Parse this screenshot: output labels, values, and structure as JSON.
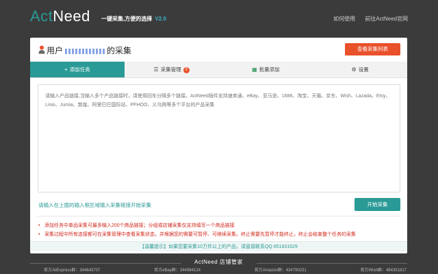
{
  "header": {
    "logo_act": "Act",
    "logo_need": "Need",
    "slogan": "一键采集,方便的选择",
    "version": "V2.0",
    "links": [
      "如何使用",
      "前往ActNeed官网"
    ]
  },
  "card": {
    "title_prefix": "用户",
    "title_suffix": "的采集",
    "view_button": "查看采集列表"
  },
  "tabs": [
    {
      "label": "添加任务",
      "icon": "plus-icon",
      "active": true
    },
    {
      "label": "采集管理",
      "icon": "list-icon",
      "badge": "3"
    },
    {
      "label": "批量添加",
      "icon": "excel-icon"
    },
    {
      "label": "设置",
      "icon": "gear-icon"
    }
  ],
  "textarea": {
    "placeholder": "请输入产品链接,当输入多个产品链接时，请使用回车分隔多个链接。ActNeed插件支持速卖通、eBay、亚马逊、1688、淘宝、天猫、京东、Wish、Lazada、Etsy、Linio、Jumia、敦煌、阿里巴巴国际站、PFHOO、义乌购等多个平台的产品采集"
  },
  "hint": "请输入在上面的输入框区域输入采集链接开始采集",
  "start_button": "开始采集",
  "notes": [
    "添加任务中单品采集可最多输入200个商品链接；分组或店铺采集仅支持填写一个商品链接",
    "采集过程中所有连接都可在采集管理中查看采集状态，并根据您的需要可暂停、可继续采集。终止需要先暂停才能终止，终止会结束整个任务的采集"
  ],
  "tip": "【温馨提示】如果您要采集10万件以上的产品，请直接联系QQ 851831629",
  "footer": {
    "title": "ActNeed 店铺管家",
    "groups": [
      "官方AliExpress群：344643707",
      "官方eBay群：344984124",
      "官方Amazon群：434790231",
      "官方Wish群：484351817"
    ]
  },
  "colors": {
    "accent": "#2a9a96",
    "danger": "#e8512a",
    "background": "#3b3b3b"
  }
}
